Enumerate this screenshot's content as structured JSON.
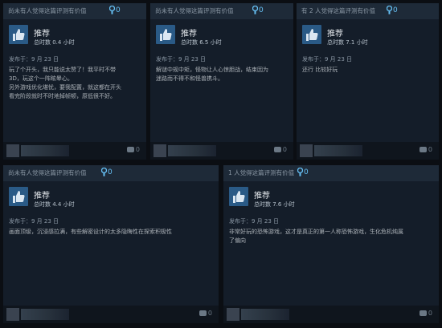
{
  "reviews": [
    {
      "helpful": "尚未有人觉得这篇评测有价值",
      "award_count": "0",
      "recommend": "推荐",
      "hours": "总时数 0.4 小时",
      "posted": "发布于：9 月 23 日",
      "text": [
        "玩了个开头，我只能说太赞了！我平时不带",
        "3D，玩这个一阵眩晕心。",
        "另外游戏优化堪忧，要我配置，就这都在开头",
        "看完阶段就时不时地掉帧顿，原低很不好。"
      ],
      "comment_count": "0"
    },
    {
      "helpful": "尚未有人觉得这篇评测有价值",
      "award_count": "0",
      "recommend": "推荐",
      "hours": "总时数 6.5 小时",
      "posted": "发布于：9 月 23 日",
      "text": [
        "解谜中规中矩，怪物让人心惊胆战，结束因为",
        "迷路而不得不和怪兽携斗。"
      ],
      "comment_count": "0"
    },
    {
      "helpful": "有 2 人觉得这篇评测有价值",
      "award_count": "0",
      "recommend": "推荐",
      "hours": "总时数 7.1 小时",
      "posted": "发布于：9 月 23 日",
      "text": [
        "还行 比较好玩"
      ],
      "comment_count": "0"
    },
    {
      "helpful": "尚未有人觉得这篇评测有价值",
      "award_count": "0",
      "recommend": "推荐",
      "hours": "总时数 4.4 小时",
      "posted": "发布于：9 月 23 日",
      "text": [
        "画面顶级，沉浸感拉满，有些解密设计的太多隐晦性在探索积极性"
      ],
      "comment_count": "0"
    },
    {
      "helpful": "1 人觉得这篇评测有价值",
      "award_count": "0",
      "recommend": "推荐",
      "hours": "总时数 7.6 小时",
      "posted": "发布于：9 月 23 日",
      "text": [
        "非常好玩的恐怖游戏，这才是真正的第一人称恐怖游戏，生化危机纯属",
        "了偏向"
      ],
      "comment_count": "0"
    }
  ],
  "colors": {
    "accent": "#66c0f4",
    "thumb_bg": "#2a5a86",
    "card_bg": "#141d29"
  }
}
